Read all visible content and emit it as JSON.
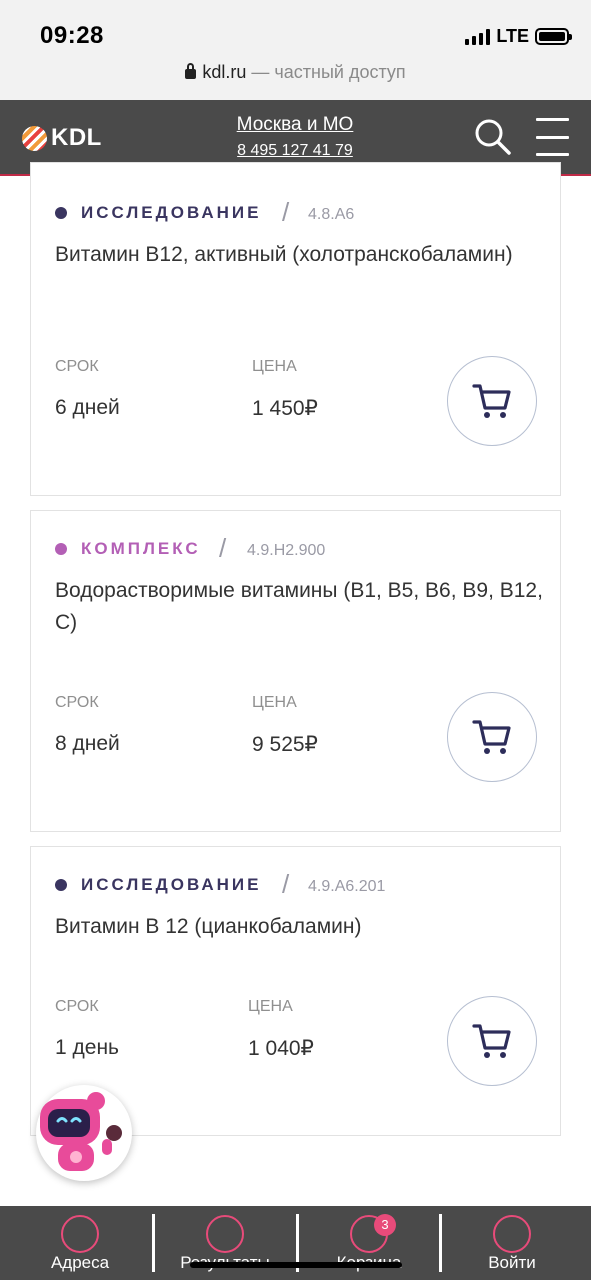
{
  "status_bar": {
    "time": "09:28",
    "network": "LTE"
  },
  "url_bar": {
    "domain": "kdl.ru",
    "suffix": "— частный доступ"
  },
  "header": {
    "logo": "KDL",
    "region": "Москва и МО",
    "phone": "8 495 127 41 79"
  },
  "labels": {
    "term": "СРОК",
    "price": "ЦЕНА"
  },
  "cards": [
    {
      "type": "ИССЛЕДОВАНИЕ",
      "type_color": "#3a3560",
      "code": "4.8.A6",
      "title": "Витамин В12, активный (холотранскобаламин)",
      "term": "6 дней",
      "price": "1 450₽"
    },
    {
      "type": "КОМПЛЕКС",
      "type_color": "#b35fb5",
      "code": "4.9.H2.900",
      "title": "Водорастворимые витамины (B1, B5, B6, B9, B12, C)",
      "term": "8 дней",
      "price": "9 525₽"
    },
    {
      "type": "ИССЛЕДОВАНИЕ",
      "type_color": "#3a3560",
      "code": "4.9.A6.201",
      "title": "Витамин В 12 (цианкобаламин)",
      "term": "1 день",
      "price": "1 040₽"
    }
  ],
  "bottom_nav": [
    {
      "label": "Адреса",
      "icon": "location-icon"
    },
    {
      "label": "Результаты",
      "icon": "results-icon"
    },
    {
      "label": "Корзина",
      "icon": "cart-icon",
      "badge": "3"
    },
    {
      "label": "Войти",
      "icon": "user-icon"
    }
  ],
  "colors": {
    "header_bg": "#4a4a4a",
    "accent": "#e84b7a",
    "cart_icon": "#2d2d5a"
  }
}
